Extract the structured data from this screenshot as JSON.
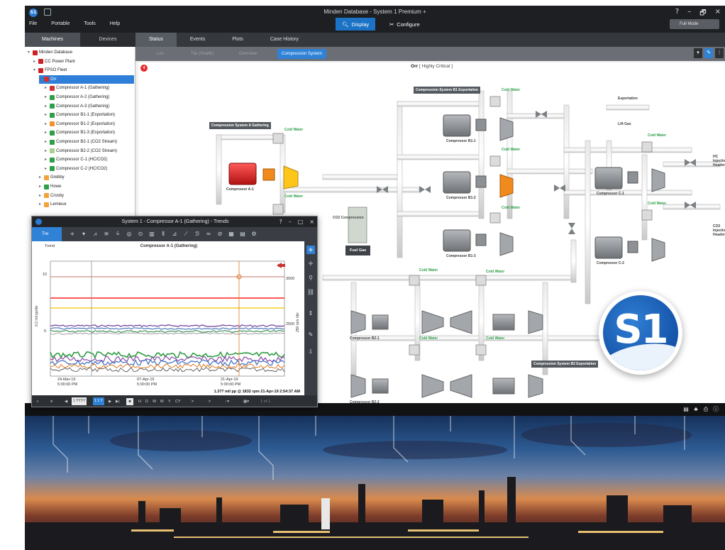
{
  "window": {
    "title": "Minden Database - System 1 Premium +",
    "logo_text": "S1",
    "controls": [
      "?",
      "–",
      "🗗",
      "×"
    ],
    "full_mode": "Full Mode"
  },
  "menu": [
    "File",
    "Portable",
    "Tools",
    "Help"
  ],
  "modes": {
    "display": "Display",
    "configure": "Configure"
  },
  "side_tabs": [
    "Machines",
    "Devices"
  ],
  "tree": [
    {
      "label": "Minden Database",
      "icon": "db",
      "toggle": "▾",
      "level": 0
    },
    {
      "label": "CC Power Plant",
      "icon": "db",
      "toggle": "▸",
      "level": 1
    },
    {
      "label": "FPSO Fleet",
      "icon": "db",
      "toggle": "▾",
      "level": 1
    },
    {
      "label": "Orr",
      "icon": "red",
      "toggle": "▾",
      "level": 2,
      "selected": true
    },
    {
      "label": "Compressor A-1 (Gathering)",
      "icon": "red",
      "toggle": "▸",
      "level": 3
    },
    {
      "label": "Compressor A-2 (Gathering)",
      "icon": "green",
      "toggle": "▸",
      "level": 3
    },
    {
      "label": "Compressor A-3 (Gathering)",
      "icon": "green",
      "toggle": "▸",
      "level": 3
    },
    {
      "label": "Compressor B1-1 (Exportation)",
      "icon": "green",
      "toggle": "▸",
      "level": 3
    },
    {
      "label": "Compressor B1-2 (Exportation)",
      "icon": "orange",
      "toggle": "▸",
      "level": 3
    },
    {
      "label": "Compressor B1-3 (Exportation)",
      "icon": "green",
      "toggle": "▸",
      "level": 3
    },
    {
      "label": "Compressor B2-1 (CO2 Stream)",
      "icon": "green",
      "toggle": "▸",
      "level": 3
    },
    {
      "label": "Compressor B2-2 (CO2 Stream)",
      "icon": "lgreen",
      "toggle": "▸",
      "level": 3
    },
    {
      "label": "Compressor C-1 (HC/CO2)",
      "icon": "green",
      "toggle": "▸",
      "level": 3
    },
    {
      "label": "Compressor C-2 (HC/CO2)",
      "icon": "green",
      "toggle": "▸",
      "level": 3
    },
    {
      "label": "Grebby",
      "icon": "fac",
      "toggle": "▸",
      "level": 2
    },
    {
      "label": "Howe",
      "icon": "green",
      "toggle": "▸",
      "level": 2
    },
    {
      "label": "Crosby",
      "icon": "fac",
      "toggle": "▸",
      "level": 2
    },
    {
      "label": "Lemieux",
      "icon": "fac",
      "toggle": "▸",
      "level": 2
    }
  ],
  "main_tabs": [
    "Status",
    "Events",
    "Plots",
    "Case History"
  ],
  "sub_tabs": [
    "List",
    "Tile (Health)",
    "Overview",
    "Compression System"
  ],
  "canvas": {
    "alarm_badge": "4",
    "status_prefix": "Orr",
    "status_value": "[ Highly Critical ]"
  },
  "diagram": {
    "system_labels": {
      "a": "Compression System A Gathering",
      "b1": "Compression System B1 Exportation",
      "b2": "Compression System B2 Exportation",
      "fuel": "Fuel Gas",
      "co2": "CO2 Compression"
    },
    "cold_water": "Cold Water",
    "outputs": {
      "exportation": "Exportation",
      "lift_gas": "Lift Gas",
      "hc_injection": "HC Injection Header",
      "co2_injection": "CO2 Injection Header"
    },
    "compressors": {
      "a1": "Compressor A-1",
      "b11": "Compressor B1-1",
      "b12": "Compressor B1-2",
      "b13": "Compressor B1-3",
      "c1": "Compressor C-1",
      "c2": "Compressor C-2",
      "b21": "Compressor B2-1",
      "b22": "Compressor B2-2"
    }
  },
  "logo": {
    "text": "S1"
  },
  "trend": {
    "title": "System 1 - Compressor A-1 (Gathering) - Trends",
    "controls": [
      "?",
      "–",
      "□",
      "×"
    ],
    "tab": "Tre",
    "header": "Trend",
    "chart_title": "Compressor A-1 (Gathering)",
    "y_left_ticks": [
      "10",
      "5"
    ],
    "y_right_ticks": [
      "3000",
      "2500"
    ],
    "y_left_label": "0.2 mil pp/div",
    "y_right_label": "250 rpm /div",
    "x_ticks": [
      [
        "24-Mar-19",
        "5:00:00 PM"
      ],
      [
        "07-Apr-19",
        "5:00:00 PM"
      ],
      [
        "21-Apr-19",
        "5:00:00 PM"
      ]
    ],
    "readout": "1.377 mil pp @ 1832 rpm 21-Apr-19 2:54:37 AM",
    "bottom": {
      "range_a": "1 YYYY",
      "range_b": "1 1 Y",
      "letters": [
        "H",
        "D",
        "W",
        "M",
        "Y",
        "CY"
      ],
      "page": "1 of 1"
    }
  },
  "colors": {
    "accent": "#2f82d6",
    "alarm": "#e42a2a",
    "ok": "#2e9e47",
    "warn": "#f2902a"
  }
}
